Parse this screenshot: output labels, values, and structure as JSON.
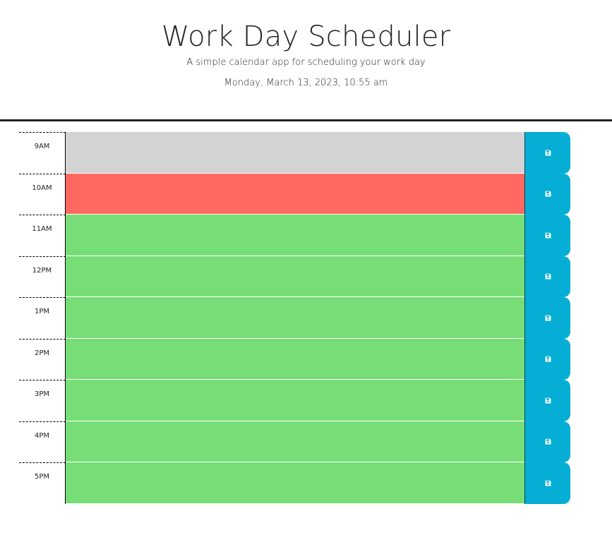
{
  "header": {
    "title": "Work Day Scheduler",
    "lead": "A simple calendar app for scheduling your work day",
    "current_datetime": "Monday, March 13, 2023, 10:55 am"
  },
  "colors": {
    "past": "#d3d3d3",
    "present": "#ff6961",
    "future": "#77dd77",
    "save_button": "#06aed5"
  },
  "icons": {
    "save": "floppy-disk-icon"
  },
  "time_blocks": [
    {
      "hour": "9AM",
      "state": "past",
      "text": ""
    },
    {
      "hour": "10AM",
      "state": "present",
      "text": ""
    },
    {
      "hour": "11AM",
      "state": "future",
      "text": ""
    },
    {
      "hour": "12PM",
      "state": "future",
      "text": ""
    },
    {
      "hour": "1PM",
      "state": "future",
      "text": ""
    },
    {
      "hour": "2PM",
      "state": "future",
      "text": ""
    },
    {
      "hour": "3PM",
      "state": "future",
      "text": ""
    },
    {
      "hour": "4PM",
      "state": "future",
      "text": ""
    },
    {
      "hour": "5PM",
      "state": "future",
      "text": ""
    }
  ]
}
